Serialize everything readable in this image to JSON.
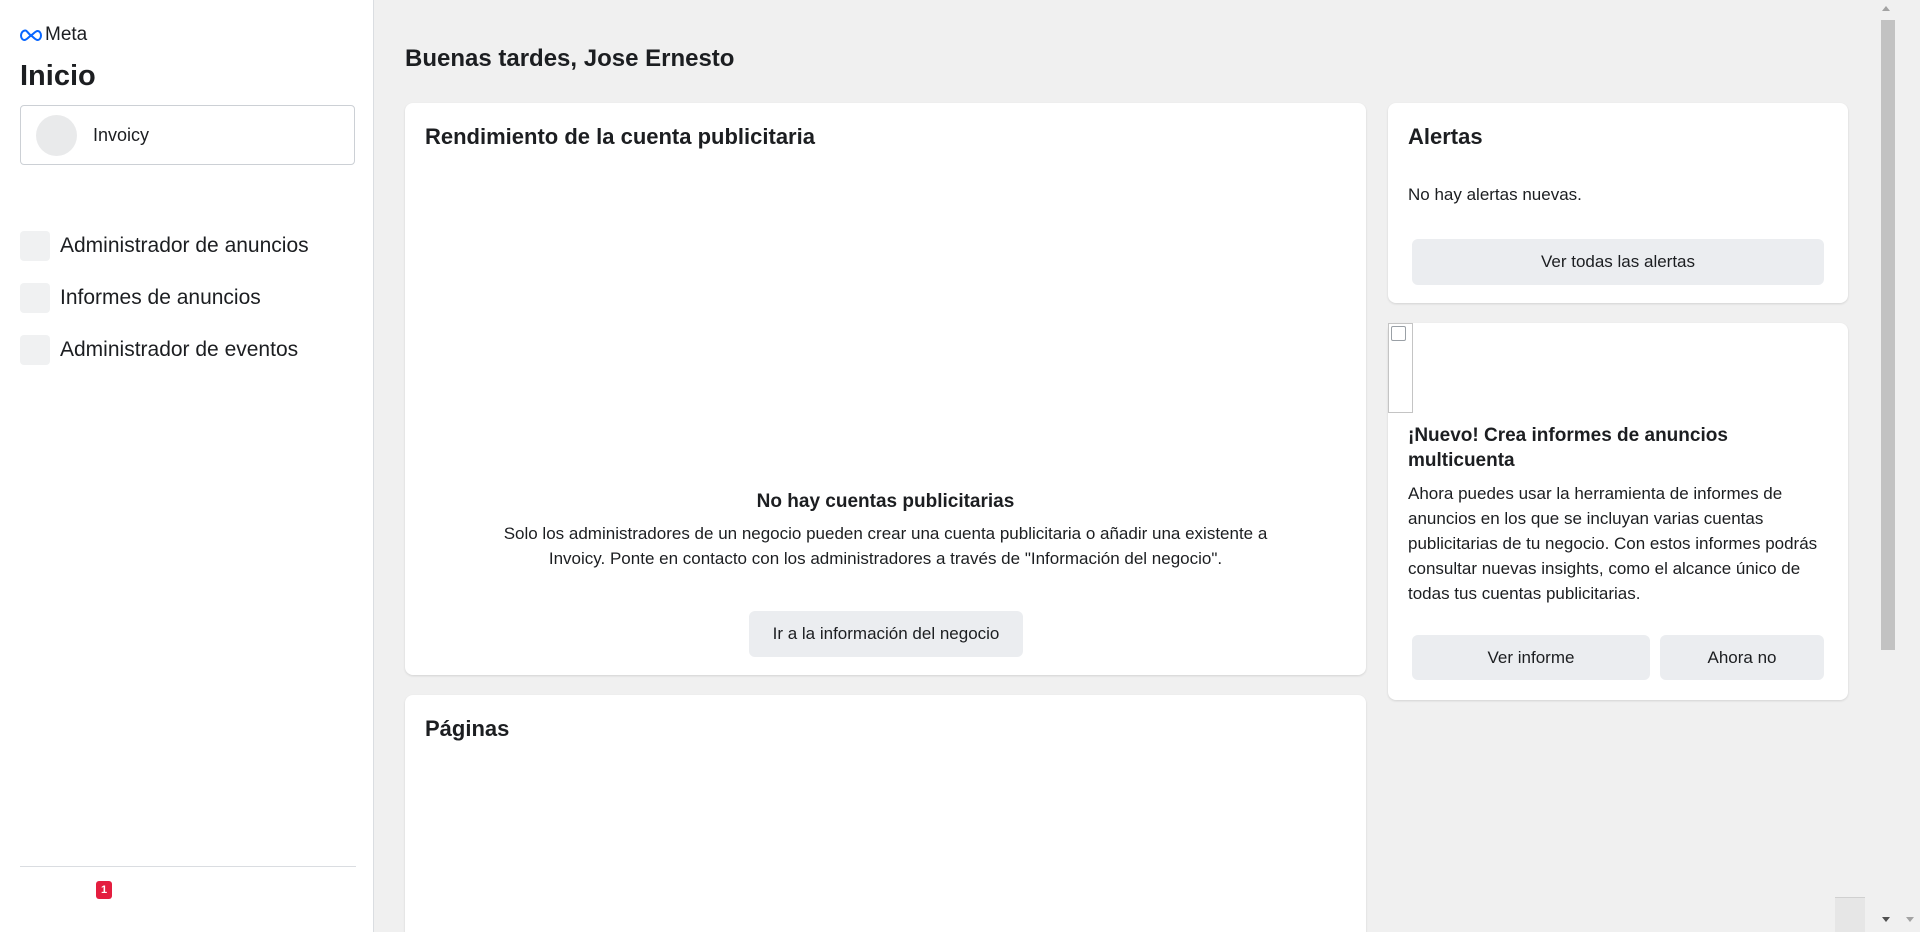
{
  "sidebar": {
    "logo_text": "Meta",
    "title": "Inicio",
    "business": {
      "name": "Invoicy"
    },
    "nav_items": [
      {
        "label": "Administrador de anuncios",
        "icon": "ads-manager-icon"
      },
      {
        "label": "Informes de anuncios",
        "icon": "ads-reporting-icon"
      },
      {
        "label": "Administrador de eventos",
        "icon": "events-manager-icon"
      }
    ],
    "notification_count": "1"
  },
  "main": {
    "greeting": "Buenas tardes, Jose Ernesto",
    "performance": {
      "title": "Rendimiento de la cuenta publicitaria",
      "empty_title": "No hay cuentas publicitarias",
      "empty_desc": "Solo los administradores de un negocio pueden crear una cuenta publicitaria o añadir una existente a Invoicy. Ponte en contacto con los administradores a través de \"Información del negocio\".",
      "button_label": "Ir a la información del negocio"
    },
    "pages": {
      "title": "Páginas"
    },
    "alerts": {
      "title": "Alertas",
      "empty_text": "No hay alertas nuevas.",
      "button_label": "Ver todas las alertas"
    },
    "promo": {
      "title": "¡Nuevo! Crea informes de anuncios multicuenta",
      "body": "Ahora puedes usar la herramienta de informes de anuncios en los que se incluyan varias cuentas publicitarias de tu negocio. Con estos informes podrás consultar nuevas insights, como el alcance único de todas tus cuentas publicitarias.",
      "primary_label": "Ver informe",
      "secondary_label": "Ahora no"
    }
  },
  "colors": {
    "meta_blue": "#0866ff",
    "badge_red": "#e41e3f",
    "button_gray": "#ebedf0",
    "page_bg": "#f0f0f0"
  }
}
